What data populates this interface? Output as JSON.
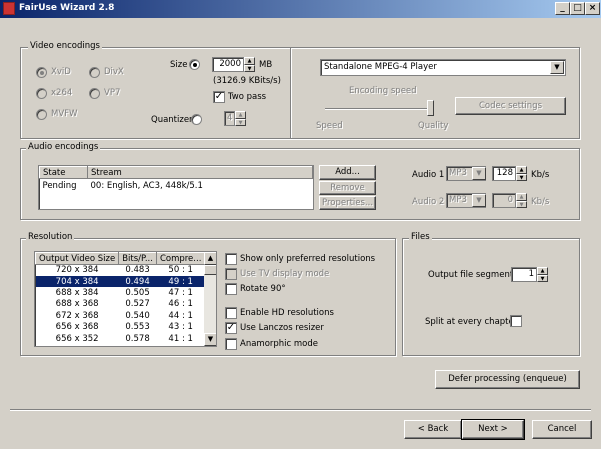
{
  "window": {
    "title": "FairUse Wizard 2.8",
    "controls": [
      "_",
      "□",
      "×"
    ]
  },
  "video": {
    "legend": "Video encodings",
    "codecs": [
      {
        "label": "XviD",
        "selected": true,
        "enabled": false
      },
      {
        "label": "DivX",
        "selected": false,
        "enabled": false
      },
      {
        "label": "x264",
        "selected": false,
        "enabled": false
      },
      {
        "label": "VP7",
        "selected": false,
        "enabled": false
      },
      {
        "label": "MVFW",
        "selected": false,
        "enabled": false
      }
    ],
    "size_label": "Size",
    "size_value": "2000",
    "size_unit": "MB",
    "bitrate": "(3126.9 KBits/s)",
    "two_pass_label": "Two pass",
    "two_pass_checked": true,
    "quantizer_label": "Quantizer",
    "quantizer_value": "4",
    "profile": "Standalone MPEG-4 Player",
    "encoding_speed_label": "Encoding speed",
    "speed_label": "Speed",
    "quality_label": "Quality",
    "slider_position": 1.0,
    "codec_settings_button": "Codec settings"
  },
  "audio": {
    "legend": "Audio encodings",
    "columns": [
      "State",
      "Stream"
    ],
    "rows": [
      {
        "state": "Pending",
        "stream": "00: English, AC3, 448k/5.1"
      }
    ],
    "add_button": "Add...",
    "remove_button": "Remove",
    "properties_button": "Properties...",
    "audio1_label": "Audio 1",
    "audio1_codec": "MP3",
    "audio1_bitrate": "128",
    "audio2_label": "Audio 2",
    "audio2_codec": "MP3",
    "audio2_bitrate": "0",
    "bitrate_unit": "Kb/s"
  },
  "resolution": {
    "legend": "Resolution",
    "columns": [
      "Output Video Size",
      "Bits/P...",
      "Compre..."
    ],
    "rows": [
      [
        "720 x 384",
        "0.483",
        "50 : 1"
      ],
      [
        "704 x 384",
        "0.494",
        "49 : 1"
      ],
      [
        "688 x 384",
        "0.505",
        "47 : 1"
      ],
      [
        "688 x 368",
        "0.527",
        "46 : 1"
      ],
      [
        "672 x 368",
        "0.540",
        "44 : 1"
      ],
      [
        "656 x 368",
        "0.553",
        "43 : 1"
      ],
      [
        "656 x 352",
        "0.578",
        "41 : 1"
      ]
    ],
    "selected_row": 1,
    "options": [
      {
        "label": "Show only preferred resolutions",
        "checked": false,
        "enabled": true
      },
      {
        "label": "Use TV display mode",
        "checked": false,
        "enabled": false
      },
      {
        "label": "Rotate 90°",
        "checked": false,
        "enabled": true
      },
      {
        "label": "Enable HD resolutions",
        "checked": false,
        "enabled": true
      },
      {
        "label": "Use Lanczos resizer",
        "checked": true,
        "enabled": true
      },
      {
        "label": "Anamorphic mode",
        "checked": false,
        "enabled": true
      }
    ]
  },
  "files": {
    "legend": "Files",
    "segments_label": "Output file segments",
    "segments_value": "1",
    "split_label": "Split at every chapter",
    "split_checked": false
  },
  "actions": {
    "defer": "Defer processing (enqueue)",
    "back": "< Back",
    "next": "Next >",
    "cancel": "Cancel"
  }
}
